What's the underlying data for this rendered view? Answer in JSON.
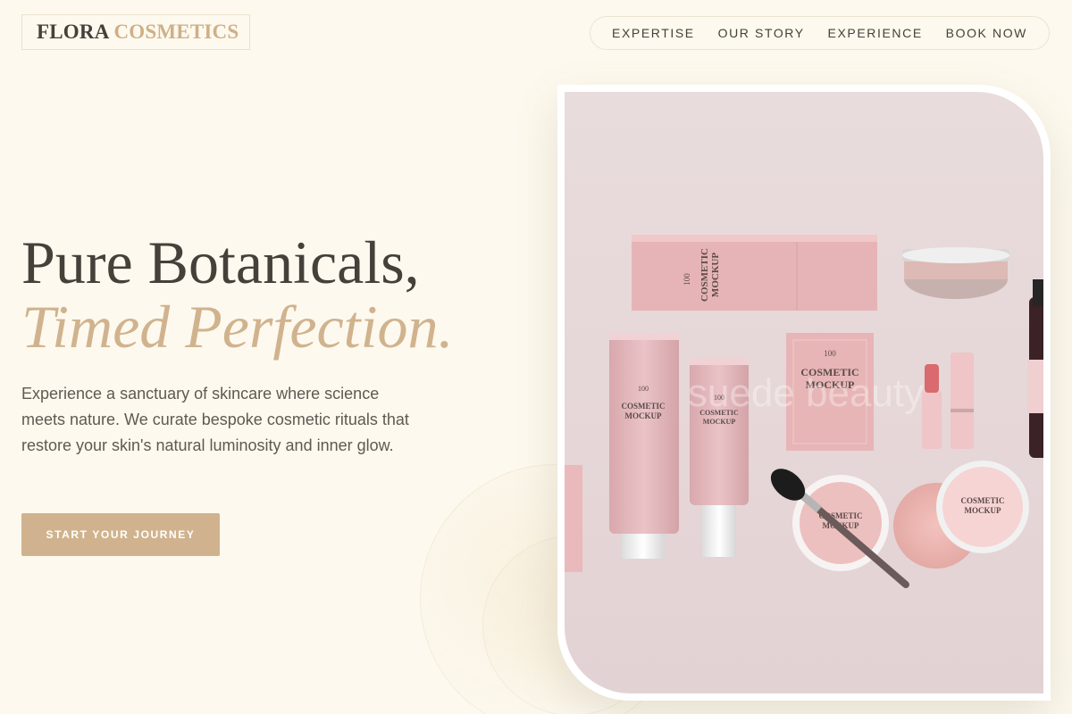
{
  "brand": {
    "name_primary": "FLORA",
    "name_secondary": "COSMETICS"
  },
  "nav": {
    "items": [
      {
        "label": "EXPERTISE"
      },
      {
        "label": "OUR STORY"
      },
      {
        "label": "EXPERIENCE"
      },
      {
        "label": "BOOK NOW"
      }
    ]
  },
  "hero": {
    "title_line1": "Pure Botanicals,",
    "title_line2": "Timed Perfection.",
    "description": "Experience a sanctuary of skincare where science meets nature. We curate bespoke cosmetic rituals that restore your skin's natural luminosity and inner glow.",
    "cta_label": "START YOUR JOURNEY"
  },
  "product_image": {
    "watermark": "suede beauty",
    "label_100": "100",
    "label_cosmetic": "COSMETIC",
    "label_mockup": "MOCKUP"
  },
  "colors": {
    "background": "#fdf9ee",
    "text_dark": "#45413a",
    "accent_gold": "#d0b38e",
    "product_pink": "#e9bcbe"
  }
}
